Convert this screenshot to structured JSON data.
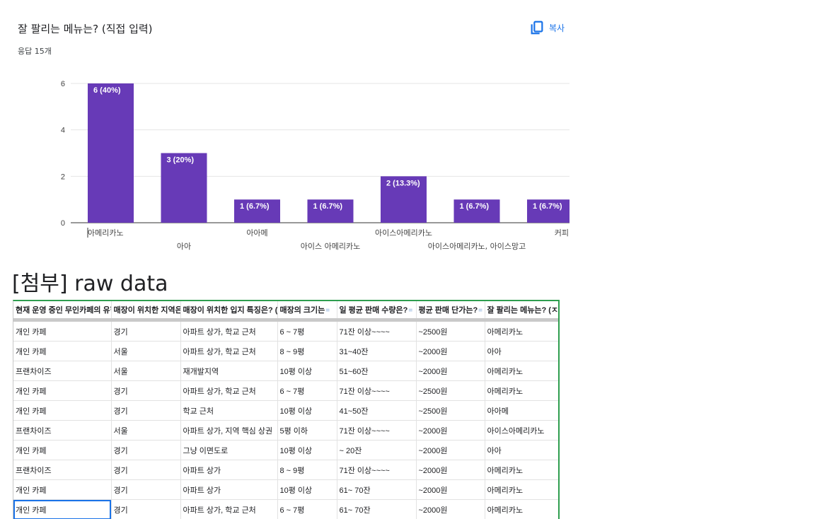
{
  "question": {
    "title": "잘 팔리는 메뉴는? (직접 입력)",
    "count": "응답 15개",
    "copy_label": "복사"
  },
  "chart_data": {
    "type": "bar",
    "categories": [
      "아메리카노",
      "아아",
      "아아메",
      "아이스 아메리카노",
      "아이스아메리카노",
      "아이스아메리카노, 아이스망고",
      "커피"
    ],
    "values": [
      6,
      3,
      1,
      1,
      2,
      1,
      1
    ],
    "data_labels": [
      "6 (40%)",
      "3 (20%)",
      "1 (6.7%)",
      "1 (6.7%)",
      "2 (13.3%)",
      "1 (6.7%)",
      "1 (6.7%)"
    ],
    "y_ticks": [
      0,
      2,
      4,
      6
    ],
    "ylim": [
      0,
      6
    ],
    "grid": true,
    "bar_color": "#673ab7"
  },
  "attachment_title": "[첨부] raw data",
  "sheet": {
    "headers": [
      {
        "label": "현재 운영 중인 무인카페의 유형",
        "filter": "=",
        "active": false
      },
      {
        "label": "매장이 위치한 지역은",
        "filter": "▼",
        "active": true
      },
      {
        "label": "매장이 위치한 입지 특징은? (중",
        "filter": "=",
        "active": false
      },
      {
        "label": "매장의 크기는",
        "filter": "=",
        "active": false
      },
      {
        "label": "일 평균 판매 수량은?",
        "filter": "=",
        "active": false
      },
      {
        "label": "평균 판매 단가는?",
        "filter": "=",
        "active": false
      },
      {
        "label": "잘 팔리는 메뉴는? (ㅈ",
        "filter": "=",
        "active": false
      }
    ],
    "rows": [
      [
        "개인 카페",
        "경기",
        "아파트 상가, 학교 근처",
        "6 ~ 7평",
        "71잔 이상~~~~",
        "~2500원",
        "아메리카노"
      ],
      [
        "개인 카페",
        "서울",
        "아파트 상가, 학교 근처",
        "8 ~ 9평",
        "31~40잔",
        "~2000원",
        "아아"
      ],
      [
        "프랜차이즈",
        "서울",
        "재개발지역",
        "10평 이상",
        "51~60잔",
        "~2000원",
        "아메리카노"
      ],
      [
        "개인 카페",
        "경기",
        "아파트 상가, 학교 근처",
        "6 ~ 7평",
        "71잔 이상~~~~",
        "~2500원",
        "아메리카노"
      ],
      [
        "개인 카페",
        "경기",
        "학교 근처",
        "10평 이상",
        "41~50잔",
        "~2500원",
        "아아메"
      ],
      [
        "프랜차이즈",
        "서울",
        "아파트 상가, 지역 핵심 상권",
        "5평 이하",
        "71잔 이상~~~~",
        "~2000원",
        "아이스아메리카노"
      ],
      [
        "개인 카페",
        "경기",
        "그냥 이면도로",
        "10평 이상",
        "~ 20잔",
        "~2000원",
        "아아"
      ],
      [
        "프랜차이즈",
        "경기",
        "아파트 상가",
        "8 ~ 9평",
        "71잔 이상~~~~",
        "~2000원",
        "아메리카노"
      ],
      [
        "개인 카페",
        "경기",
        "아파트 상가",
        "10평 이상",
        "61~ 70잔",
        "~2000원",
        "아메리카노"
      ],
      [
        "개인 카페",
        "경기",
        "아파트 상가, 학교 근처",
        "6 ~ 7평",
        "61~ 70잔",
        "~2000원",
        "아메리카노"
      ]
    ]
  }
}
